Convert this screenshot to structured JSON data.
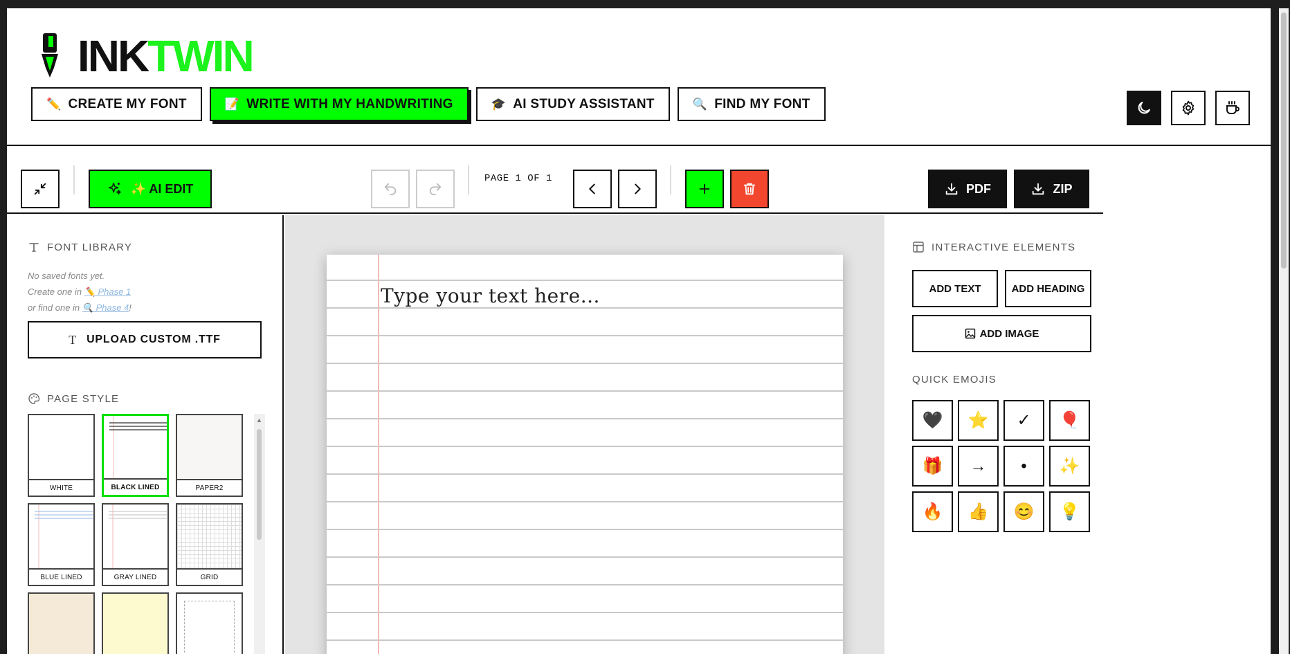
{
  "brand": {
    "ink": "INK",
    "twin": "TWIN",
    "accent": "#00ff00"
  },
  "nav": [
    {
      "icon": "✏️",
      "label": "CREATE MY FONT"
    },
    {
      "icon": "📝",
      "label": "WRITE WITH MY HANDWRITING"
    },
    {
      "icon": "🎓",
      "label": "AI STUDY ASSISTANT"
    },
    {
      "icon": "🔍",
      "label": "FIND MY FONT"
    }
  ],
  "toolbar": {
    "ai_edit_label": "✨ AI EDIT",
    "page_indicator": "PAGE 1 OF 1",
    "pdf_label": "PDF",
    "zip_label": "ZIP"
  },
  "font_library": {
    "title": "FONT LIBRARY",
    "empty": "No saved fonts yet.",
    "create_prefix": "Create one in ",
    "create_link": "✏️ Phase 1",
    "find_prefix": "or find one in ",
    "find_link": "🔍 Phase 4",
    "find_suffix": "!",
    "upload_label": "UPLOAD CUSTOM .TTF"
  },
  "page_style": {
    "title": "PAGE STYLE",
    "options": [
      "WHITE",
      "BLACK LINED",
      "PAPER2",
      "BLUE LINED",
      "GRAY LINED",
      "GRID"
    ]
  },
  "editor": {
    "placeholder": "Type your text here..."
  },
  "interactive": {
    "title": "INTERACTIVE ELEMENTS",
    "add_text": "ADD TEXT",
    "add_heading": "ADD HEADING",
    "add_image": "ADD IMAGE"
  },
  "quick_emojis": {
    "title": "QUICK EMOJIS",
    "items": [
      "🖤",
      "⭐",
      "✓",
      "🎈",
      "🎁",
      "→",
      "•",
      "✨",
      "🔥",
      "👍",
      "😊",
      "💡"
    ]
  }
}
